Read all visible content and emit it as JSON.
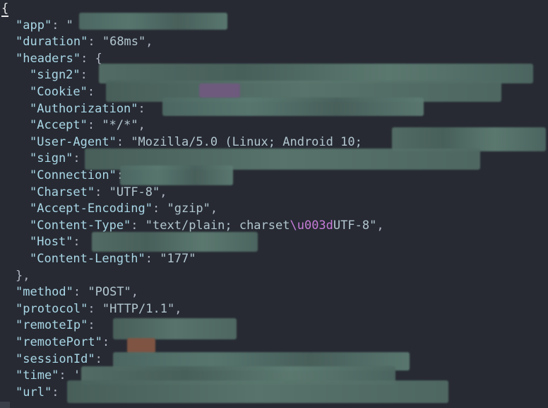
{
  "editor": {
    "lines": [
      {
        "indent": 0,
        "parts": [
          {
            "t": "brace",
            "v": "{"
          }
        ]
      },
      {
        "indent": 1,
        "parts": [
          {
            "t": "key",
            "v": "\"app\""
          },
          {
            "t": "punc",
            "v": ": "
          },
          {
            "t": "str",
            "v": "\""
          }
        ]
      },
      {
        "indent": 1,
        "parts": [
          {
            "t": "key",
            "v": "\"duration\""
          },
          {
            "t": "punc",
            "v": ": "
          },
          {
            "t": "str",
            "v": "\"68ms\""
          },
          {
            "t": "punc",
            "v": ","
          }
        ]
      },
      {
        "indent": 1,
        "parts": [
          {
            "t": "key",
            "v": "\"headers\""
          },
          {
            "t": "punc",
            "v": ": {"
          }
        ]
      },
      {
        "indent": 2,
        "parts": [
          {
            "t": "key",
            "v": "\"sign2\""
          },
          {
            "t": "punc",
            "v": ":"
          }
        ]
      },
      {
        "indent": 2,
        "parts": [
          {
            "t": "key",
            "v": "\"Cookie\""
          },
          {
            "t": "punc",
            "v": ":"
          }
        ]
      },
      {
        "indent": 2,
        "parts": [
          {
            "t": "key",
            "v": "\"Authorization\""
          },
          {
            "t": "punc",
            "v": ":"
          }
        ]
      },
      {
        "indent": 2,
        "parts": [
          {
            "t": "key",
            "v": "\"Accept\""
          },
          {
            "t": "punc",
            "v": ": "
          },
          {
            "t": "str",
            "v": "\"*/*\""
          },
          {
            "t": "punc",
            "v": ","
          }
        ]
      },
      {
        "indent": 2,
        "parts": [
          {
            "t": "key",
            "v": "\"User-Agent\""
          },
          {
            "t": "punc",
            "v": ": "
          },
          {
            "t": "str",
            "v": "\"Mozilla/5.0 (Linux; Android 10;"
          }
        ]
      },
      {
        "indent": 2,
        "parts": [
          {
            "t": "key",
            "v": "\"sign\""
          },
          {
            "t": "punc",
            "v": ":"
          }
        ]
      },
      {
        "indent": 2,
        "parts": [
          {
            "t": "key",
            "v": "\"Connection\""
          },
          {
            "t": "punc",
            "v": ":"
          }
        ]
      },
      {
        "indent": 2,
        "parts": [
          {
            "t": "key",
            "v": "\"Charset\""
          },
          {
            "t": "punc",
            "v": ": "
          },
          {
            "t": "str",
            "v": "\"UTF-8\""
          },
          {
            "t": "punc",
            "v": ","
          }
        ]
      },
      {
        "indent": 2,
        "parts": [
          {
            "t": "key",
            "v": "\"Accept-Encoding\""
          },
          {
            "t": "punc",
            "v": ": "
          },
          {
            "t": "str",
            "v": "\"gzip\""
          },
          {
            "t": "punc",
            "v": ","
          }
        ]
      },
      {
        "indent": 2,
        "parts": [
          {
            "t": "key",
            "v": "\"Content-Type\""
          },
          {
            "t": "punc",
            "v": ": "
          },
          {
            "t": "str",
            "v": "\"text/plain; charset"
          },
          {
            "t": "esc",
            "v": "\\u003d"
          },
          {
            "t": "str",
            "v": "UTF-8\""
          },
          {
            "t": "punc",
            "v": ","
          }
        ]
      },
      {
        "indent": 2,
        "parts": [
          {
            "t": "key",
            "v": "\"Host\""
          },
          {
            "t": "punc",
            "v": ":"
          }
        ]
      },
      {
        "indent": 2,
        "parts": [
          {
            "t": "key",
            "v": "\"Content-Length\""
          },
          {
            "t": "punc",
            "v": ": "
          },
          {
            "t": "str",
            "v": "\"177\""
          }
        ]
      },
      {
        "indent": 1,
        "parts": [
          {
            "t": "punc",
            "v": "},"
          }
        ]
      },
      {
        "indent": 1,
        "parts": [
          {
            "t": "key",
            "v": "\"method\""
          },
          {
            "t": "punc",
            "v": ": "
          },
          {
            "t": "str",
            "v": "\"POST\""
          },
          {
            "t": "punc",
            "v": ","
          }
        ]
      },
      {
        "indent": 1,
        "parts": [
          {
            "t": "key",
            "v": "\"protocol\""
          },
          {
            "t": "punc",
            "v": ": "
          },
          {
            "t": "str",
            "v": "\"HTTP/1.1\""
          },
          {
            "t": "punc",
            "v": ","
          }
        ]
      },
      {
        "indent": 1,
        "parts": [
          {
            "t": "key",
            "v": "\"remoteIp\""
          },
          {
            "t": "punc",
            "v": ":"
          }
        ]
      },
      {
        "indent": 1,
        "parts": [
          {
            "t": "key",
            "v": "\"remotePort\""
          },
          {
            "t": "punc",
            "v": ":"
          }
        ]
      },
      {
        "indent": 1,
        "parts": [
          {
            "t": "key",
            "v": "\"sessionId\""
          },
          {
            "t": "punc",
            "v": ":"
          }
        ]
      },
      {
        "indent": 1,
        "parts": [
          {
            "t": "key",
            "v": "\"time\""
          },
          {
            "t": "punc",
            "v": ": "
          },
          {
            "t": "str",
            "v": "'"
          }
        ]
      },
      {
        "indent": 1,
        "parts": [
          {
            "t": "key",
            "v": "\"url\""
          },
          {
            "t": "punc",
            "v": ":"
          }
        ]
      }
    ],
    "redactions": [
      {
        "name": "app-value-redacted"
      },
      {
        "name": "sign2-value-redacted"
      },
      {
        "name": "cookie-value-redacted"
      },
      {
        "name": "authorization-value-redacted"
      },
      {
        "name": "user-agent-tail-redacted"
      },
      {
        "name": "sign-value-redacted"
      },
      {
        "name": "connection-value-redacted"
      },
      {
        "name": "host-value-redacted"
      },
      {
        "name": "remote-ip-redacted"
      },
      {
        "name": "remote-port-redacted"
      },
      {
        "name": "session-id-redacted"
      },
      {
        "name": "time-value-redacted"
      },
      {
        "name": "url-value-redacted"
      }
    ]
  }
}
